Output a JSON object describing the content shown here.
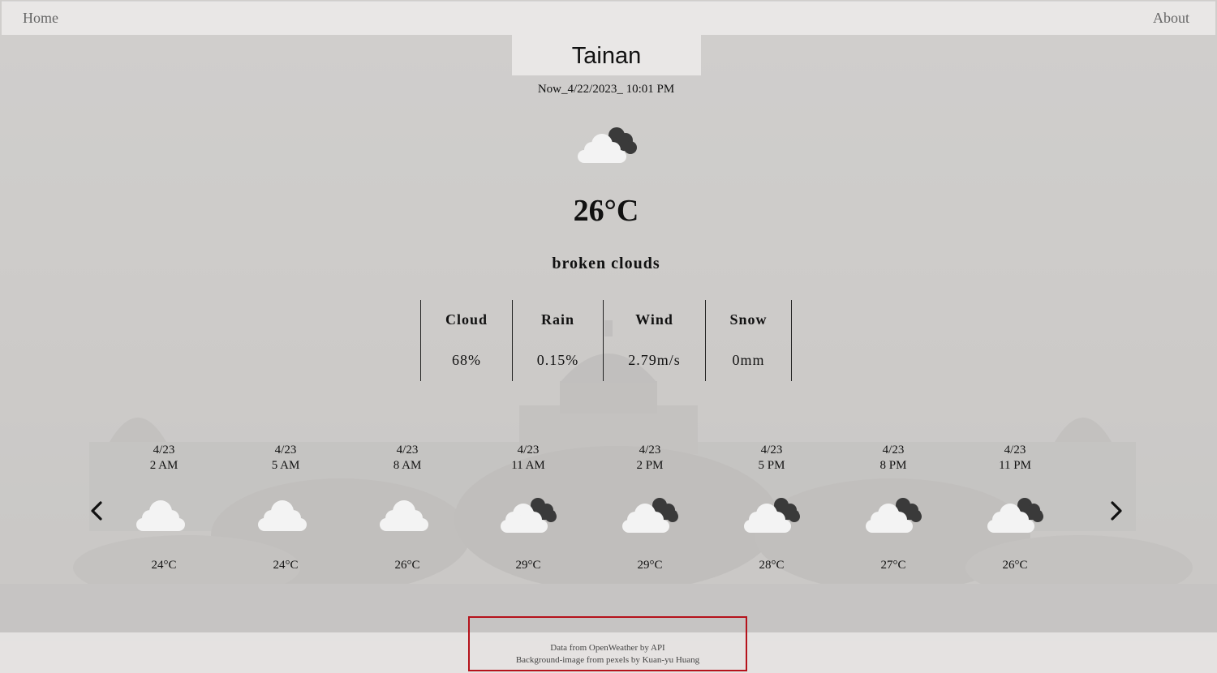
{
  "nav": {
    "home_label": "Home",
    "about_label": "About"
  },
  "current": {
    "city": "Tainan",
    "datetime": "Now_4/22/2023_ 10:01 PM",
    "icon": "broken-clouds-night-icon",
    "temperature": "26°C",
    "description": "broken clouds"
  },
  "stats": [
    {
      "label": "Cloud",
      "value": "68%"
    },
    {
      "label": "Rain",
      "value": "0.15%"
    },
    {
      "label": "Wind",
      "value": "2.79m/s"
    },
    {
      "label": "Snow",
      "value": "0mm"
    }
  ],
  "forecast": [
    {
      "date": "4/23",
      "time": "2 AM",
      "temp": "24°C",
      "icon": "cloud-icon"
    },
    {
      "date": "4/23",
      "time": "5 AM",
      "temp": "24°C",
      "icon": "cloud-icon"
    },
    {
      "date": "4/23",
      "time": "8 AM",
      "temp": "26°C",
      "icon": "cloud-icon"
    },
    {
      "date": "4/23",
      "time": "11 AM",
      "temp": "29°C",
      "icon": "broken-clouds-icon"
    },
    {
      "date": "4/23",
      "time": "2 PM",
      "temp": "29°C",
      "icon": "broken-clouds-icon"
    },
    {
      "date": "4/23",
      "time": "5 PM",
      "temp": "28°C",
      "icon": "broken-clouds-icon"
    },
    {
      "date": "4/23",
      "time": "8 PM",
      "temp": "27°C",
      "icon": "broken-clouds-icon"
    },
    {
      "date": "4/23",
      "time": "11 PM",
      "temp": "26°C",
      "icon": "broken-clouds-icon"
    }
  ],
  "carousel": {
    "prev_icon": "chevron-left-icon",
    "next_icon": "chevron-right-icon"
  },
  "footer": {
    "line1": "Data from OpenWeather by API",
    "line2": "Background-image from pexels by Kuan-yu Huang",
    "highlight_color": "#b5121b"
  }
}
